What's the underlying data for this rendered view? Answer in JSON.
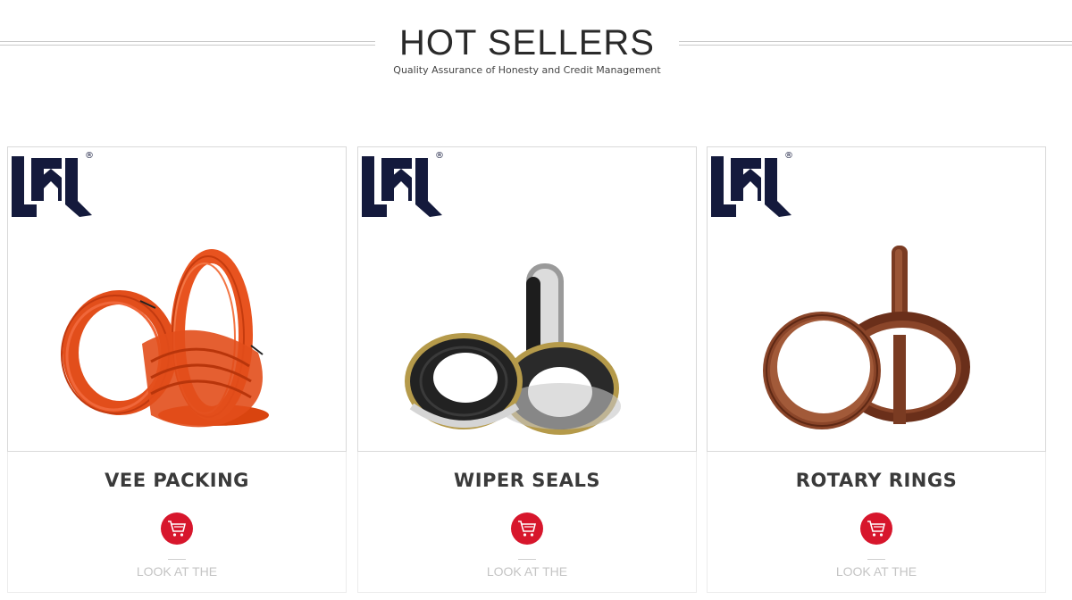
{
  "section": {
    "title": "HOT SELLERS",
    "subtitle": "Quality Assurance of Honesty and Credit Management"
  },
  "products": [
    {
      "name": "VEE PACKING",
      "more_label": "LOOK AT THE",
      "image_icon": "vee-packing-rings",
      "accent": "#e8531f"
    },
    {
      "name": "WIPER SEALS",
      "more_label": "LOOK AT THE",
      "image_icon": "wiper-seals",
      "accent": "#1f1f1f"
    },
    {
      "name": "ROTARY RINGS",
      "more_label": "LOOK AT THE",
      "image_icon": "rotary-rings",
      "accent": "#7a3b22"
    }
  ],
  "brand": {
    "logo_mark": "®",
    "logo_color": "#141a3c"
  },
  "colors": {
    "cart_button": "#d7162c"
  }
}
